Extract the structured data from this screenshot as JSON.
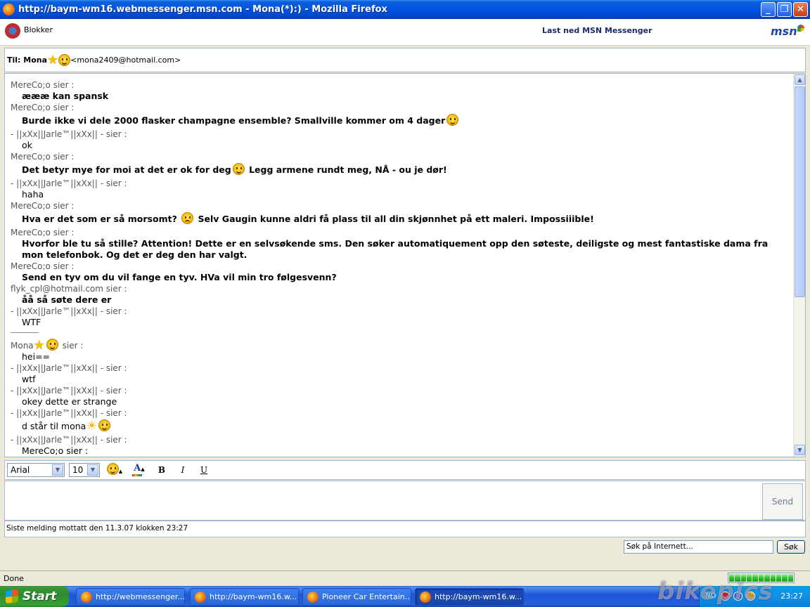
{
  "window": {
    "title": "http://baym-wm16.webmessenger.msn.com - Mona(*):) - Mozilla Firefox",
    "minimize_glyph": "_",
    "maximize_glyph": "❐",
    "close_glyph": "✕"
  },
  "topbar": {
    "block_label": "Blokker",
    "download_link": "Last ned MSN Messenger",
    "logo_text": "msn"
  },
  "to": {
    "label": "Til: Mona",
    "address": "<mona2409@hotmail.com>"
  },
  "conversation": [
    {
      "sender": "MereCo;o sier :",
      "text": "æææ kan spansk",
      "bold": true
    },
    {
      "sender": "MereCo;o sier :",
      "text": "Burde ikke vi dele 2000 flasker champagne ensemble? Smallville kommer om 4 dager",
      "bold": true,
      "emoticon_after": "smile"
    },
    {
      "sender": "- ||xXx||Jarle™||xXx|| - sier :",
      "text": "ok",
      "bold": false
    },
    {
      "sender": "MereCo;o sier :",
      "text": "Det betyr mye for moi at det er ok for deg",
      "text2": " Legg armene rundt meg, NÅ - ou je dør!",
      "bold": true,
      "emoticon_mid": "smile"
    },
    {
      "sender": "- ||xXx||Jarle™||xXx|| - sier :",
      "text": "haha",
      "bold": false
    },
    {
      "sender": "MereCo;o sier :",
      "text": "Hva er det som er så morsomt? ",
      "text2": " Selv Gaugin kunne aldri få plass til all din skjønnhet på ett maleri. Impossiiible!",
      "bold": true,
      "emoticon_mid": "sad"
    },
    {
      "sender": "MereCo;o sier :",
      "text": "Hvorfor ble tu så stille? Attention! Dette er en selvsøkende sms. Den søker automatiquement opp den søteste, deiligste og mest fantastiske dama fra mon telefonbok. Og det er deg den har valgt.",
      "bold": true
    },
    {
      "sender": "MereCo;o sier :",
      "text": "Send en tyv om du vil fange en tyv. HVa vil min tro følgesvenn?",
      "bold": true
    },
    {
      "sender": "flyk_cpl@hotmail.com sier :",
      "text": "åå så søte dere er",
      "bold": true
    },
    {
      "sender": "- ||xXx||Jarle™||xXx|| - sier :",
      "text": "WTF",
      "bold": false
    }
  ],
  "conversation2": [
    {
      "sender": "sier :",
      "text": "hei==",
      "bold": false,
      "sender_prefix": "Mona"
    },
    {
      "sender": "- ||xXx||Jarle™||xXx|| - sier :",
      "text": "wtf",
      "bold": false
    },
    {
      "sender": "- ||xXx||Jarle™||xXx|| - sier :",
      "text": "okey dette er strange",
      "bold": false
    },
    {
      "sender": "- ||xXx||Jarle™||xXx|| - sier :",
      "text": "d står til mona",
      "bold": false
    },
    {
      "sender": "- ||xXx||Jarle™||xXx|| - sier :",
      "text": "MereCo;o sier :",
      "bold": false
    }
  ],
  "format": {
    "font": "Arial",
    "size": "10",
    "bold": "B",
    "italic": "I",
    "underline": "U",
    "color_glyph": "A"
  },
  "input": {
    "send_label": "Send"
  },
  "status": {
    "text": "Siste melding mottatt den 11.3.07 klokken 23:27"
  },
  "search": {
    "value": "Søk på Internett...",
    "button": "Søk"
  },
  "browser_status": "Done",
  "taskbar": {
    "start": "Start",
    "tasks": [
      {
        "label": "http://webmessenger...",
        "active": false
      },
      {
        "label": "http://baym-wm16.w...",
        "active": false
      },
      {
        "label": "Pioneer Car Entertain...",
        "active": false
      },
      {
        "label": "http://baym-wm16.w...",
        "active": true
      }
    ],
    "lang": "NO",
    "clock": "23:27"
  },
  "watermark": "bikepics",
  "colors": {
    "titlebar": "#0354e1",
    "taskbar": "#245edb",
    "start": "#36a136",
    "border": "#a5b7cc"
  }
}
